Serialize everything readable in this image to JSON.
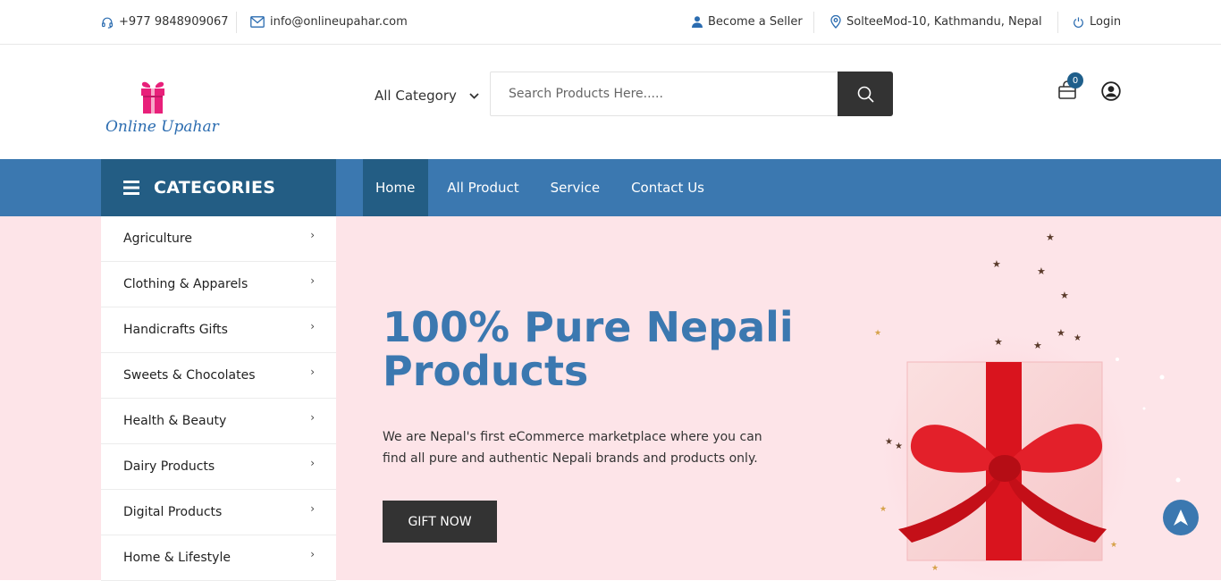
{
  "topbar": {
    "phone": "+977 9848909067",
    "email": "info@onlineupahar.com",
    "become_seller": "Become a Seller",
    "location": "SolteeMod-10, Kathmandu, Nepal",
    "login": "Login"
  },
  "header": {
    "logo_text": "Online Upahar",
    "category_select": "All Category",
    "search_placeholder": "Search Products Here.....",
    "cart_count": "0"
  },
  "nav": {
    "categories_title": "CATEGORIES",
    "links": [
      "Home",
      "All Product",
      "Service",
      "Contact Us"
    ]
  },
  "categories": [
    "Agriculture",
    "Clothing & Apparels",
    "Handicrafts Gifts",
    "Sweets & Chocolates",
    "Health & Beauty",
    "Dairy Products",
    "Digital Products",
    "Home & Lifestyle"
  ],
  "hero": {
    "headline": "100% Pure Nepali Products",
    "description": "We are Nepal's first eCommerce marketplace where you can find all pure and authentic Nepali brands and products only.",
    "button": "GIFT NOW"
  },
  "colors": {
    "primary": "#3b78b0",
    "primary_dark": "#235d84",
    "hero_bg": "#fde4e8",
    "button_dark": "#333333"
  },
  "icons": [
    "headset-icon",
    "mail-icon",
    "user-icon",
    "location-pin-icon",
    "power-icon",
    "chevron-down-icon",
    "search-icon",
    "cart-icon",
    "user-circle-icon",
    "menu-bars-icon",
    "chevron-right-icon",
    "arrow-up-icon"
  ]
}
